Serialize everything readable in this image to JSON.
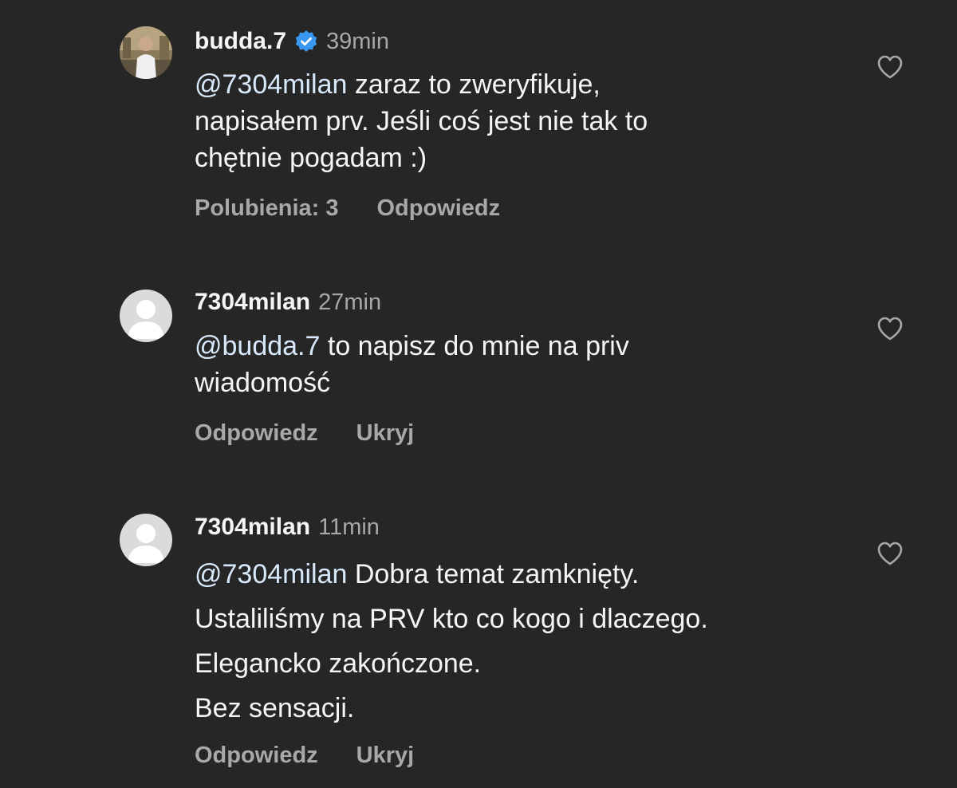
{
  "comments": [
    {
      "username": "budda.7",
      "verified": true,
      "time": "39min",
      "mention": "@7304milan",
      "lines": [
        " zaraz to zweryfikuje,",
        "napisałem prv. Jeśli coś jest nie tak to",
        "chętnie pogadam :)"
      ],
      "actions": [
        "Polubienia: 3",
        "Odpowiedz"
      ]
    },
    {
      "username": "7304milan",
      "verified": false,
      "time": "27min",
      "mention": "@budda.7",
      "lines": [
        " to napisz do mnie na priv",
        "wiadomość"
      ],
      "actions": [
        "Odpowiedz",
        "Ukryj"
      ]
    },
    {
      "username": "7304milan",
      "verified": false,
      "time": "11min",
      "mention": "@7304milan",
      "lines": [
        " Dobra temat zamknięty.",
        "Ustaliliśmy na PRV kto co kogo i dlaczego.",
        "Elegancko zakończone.",
        "Bez sensacji."
      ],
      "actions": [
        "Odpowiedz",
        "Ukryj"
      ]
    }
  ],
  "colors": {
    "background": "#262626",
    "text": "#f5f5f5",
    "secondary": "#a8a8a8",
    "verified": "#3897f0"
  },
  "icons": {
    "verified": "verified-badge-icon",
    "like": "heart-outline-icon",
    "default_avatar": "person-silhouette-icon"
  }
}
